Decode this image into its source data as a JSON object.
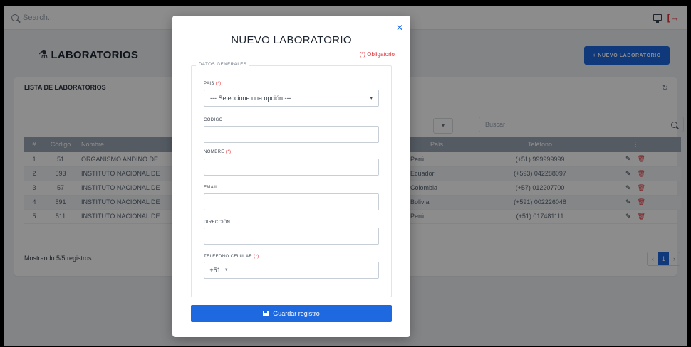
{
  "topbar": {
    "search_placeholder": "Search..."
  },
  "page": {
    "title": "LABORATORIOS",
    "new_button": "+ NUEVO LABORATORIO"
  },
  "card": {
    "title": "LISTA DE LABORATORIOS",
    "search_placeholder": "Buscar",
    "columns": [
      "#",
      "Código",
      "Nombre",
      "País",
      "Teléfono",
      "⋮"
    ],
    "rows": [
      {
        "n": "1",
        "codigo": "51",
        "nombre": "ORGANISMO ANDINO DE",
        "pais": "Perú",
        "telefono": "(+51) 999999999",
        "flag": "peru"
      },
      {
        "n": "2",
        "codigo": "593",
        "nombre": "INSTITUTO NACIONAL DE",
        "pais": "Ecuador",
        "telefono": "(+593) 042288097",
        "flag": "ecuador"
      },
      {
        "n": "3",
        "codigo": "57",
        "nombre": "INSTITUTO NACIONAL DE",
        "pais": "Colombia",
        "telefono": "(+57) 012207700",
        "flag": "colombia"
      },
      {
        "n": "4",
        "codigo": "591",
        "nombre": "INSTITUTO NACIONAL DE",
        "pais": "Bolivia",
        "telefono": "(+591) 002226048",
        "flag": "bolivia"
      },
      {
        "n": "5",
        "codigo": "511",
        "nombre": "INSTITUTO NACIONAL DE",
        "pais": "Perú",
        "telefono": "(+51) 017481111",
        "flag": "peru"
      }
    ],
    "showing": "Mostrando 5/5 registros",
    "pager": {
      "prev": "‹",
      "current": "1",
      "next": "›"
    }
  },
  "modal": {
    "title": "NUEVO LABORATORIO",
    "required_note": "(*) Obligatorio",
    "section": "DATOS GENERALES",
    "fields": {
      "pais": {
        "label": "PAIS",
        "req": "(*)",
        "value": "--- Seleccione una opción ---"
      },
      "codigo": {
        "label": "CÓDIGO"
      },
      "nombre": {
        "label": "NOMBRE",
        "req": "(*)"
      },
      "email": {
        "label": "EMAIL"
      },
      "direccion": {
        "label": "DIRECCIÓN"
      },
      "telefono": {
        "label": "TELÉFONO CELULAR",
        "req": "(*)",
        "code": "+51"
      }
    },
    "save_button": "Guardar registro"
  },
  "colors": {
    "primary": "#1e68e0",
    "danger": "#e0343c",
    "table_header": "#9ba7b5"
  },
  "icons": [
    "search-icon",
    "monitor-icon",
    "logout-icon",
    "flask-icon",
    "refresh-icon",
    "close-icon",
    "pencil-icon",
    "trash-icon",
    "save-icon",
    "chevron-down-icon"
  ]
}
